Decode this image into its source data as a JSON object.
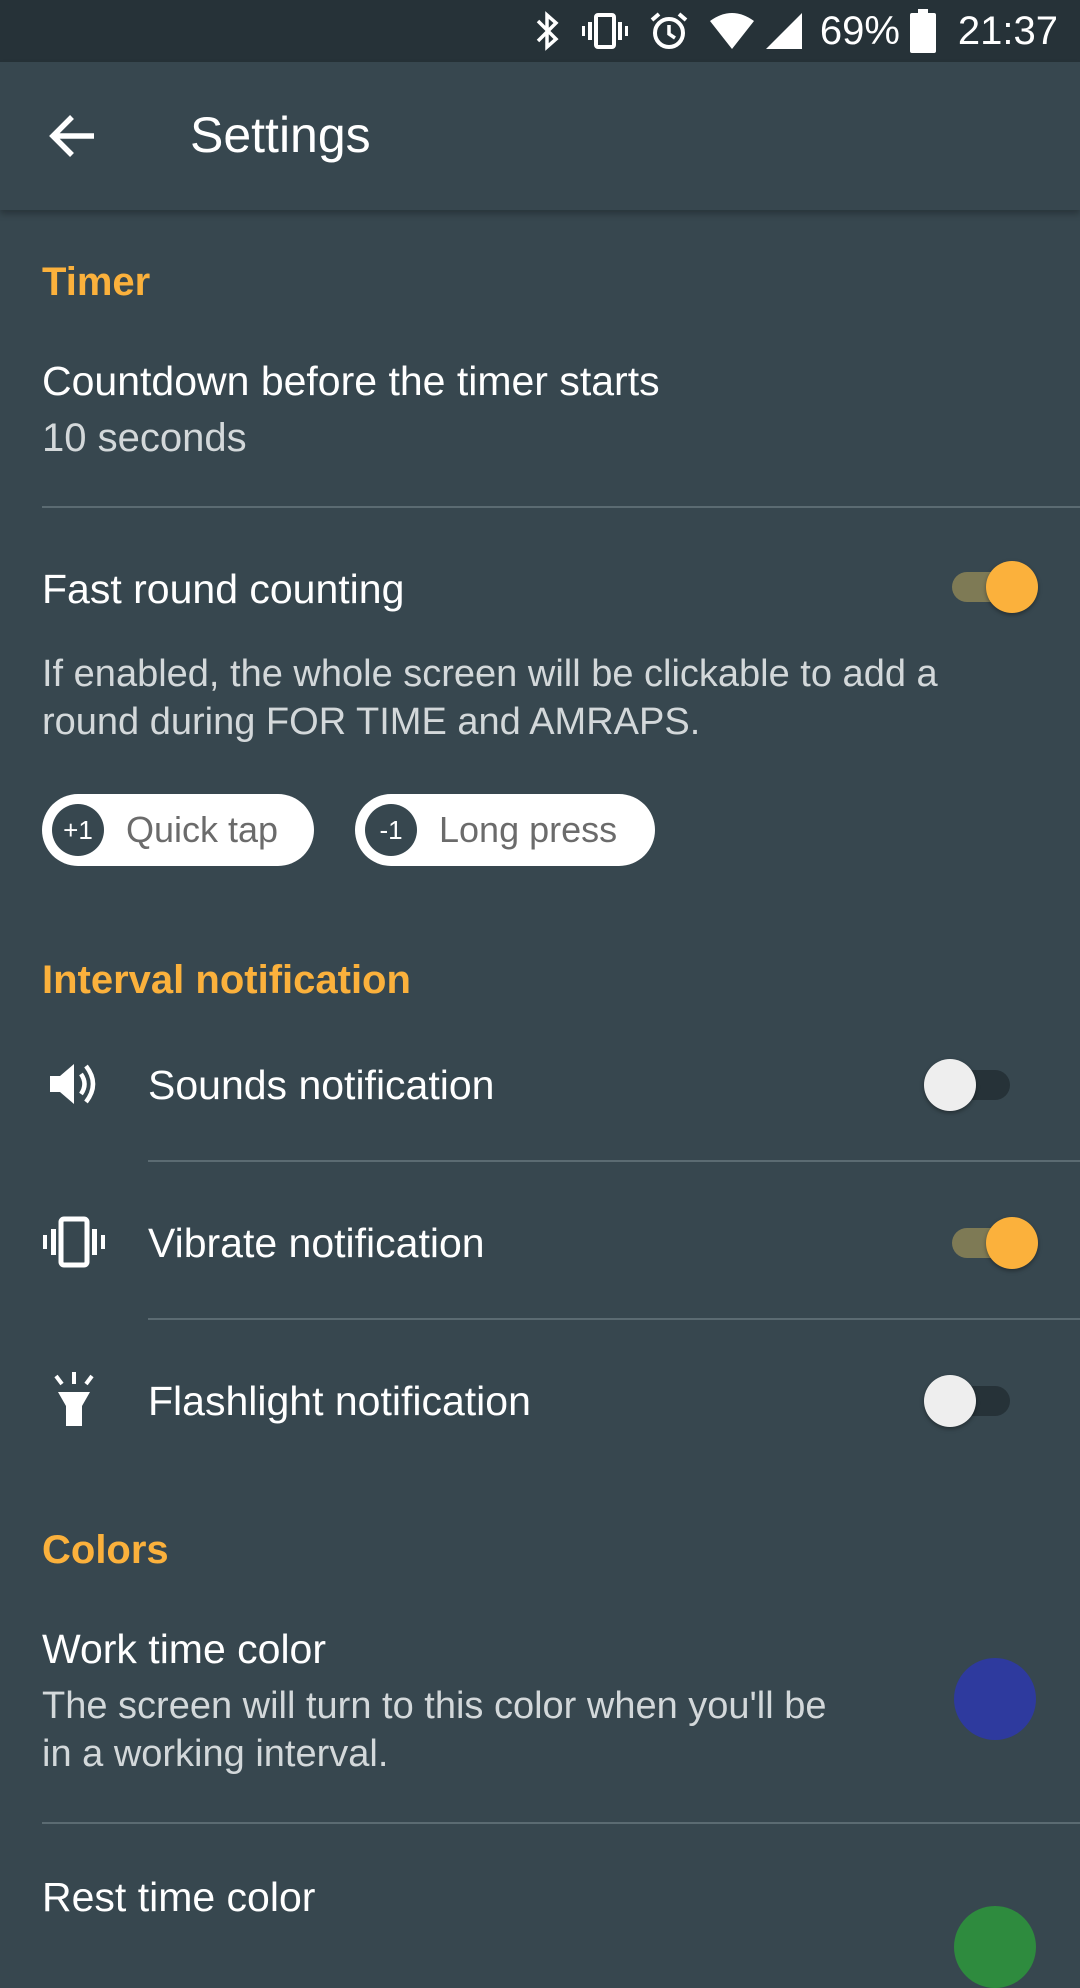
{
  "status_bar": {
    "battery": "69%",
    "time": "21:37",
    "icons": [
      "bluetooth-icon",
      "vibrate-icon",
      "alarm-icon",
      "wifi-icon",
      "signal-icon",
      "battery-icon"
    ]
  },
  "appbar": {
    "title": "Settings",
    "back_icon": "arrow-back-icon"
  },
  "accent_color": "#fbb13c",
  "sections": {
    "timer": {
      "header": "Timer",
      "countdown": {
        "title": "Countdown before the timer starts",
        "value": "10 seconds"
      },
      "fast_round": {
        "title": "Fast round counting",
        "enabled": true,
        "description_line1": "If enabled, the whole screen will be clickable to add a",
        "description_line2": "round during FOR TIME and AMRAPS.",
        "chips": [
          {
            "badge": "+1",
            "label": "Quick tap"
          },
          {
            "badge": "-1",
            "label": "Long press"
          }
        ]
      }
    },
    "interval": {
      "header": "Interval notification",
      "items": [
        {
          "label": "Sounds notification",
          "icon": "volume-icon",
          "enabled": false
        },
        {
          "label": "Vibrate notification",
          "icon": "vibrate-icon",
          "enabled": true
        },
        {
          "label": "Flashlight notification",
          "icon": "flashlight-icon",
          "enabled": false
        }
      ]
    },
    "colors": {
      "header": "Colors",
      "work": {
        "title": "Work time color",
        "description_line1": "The screen will turn to this color when you'll be",
        "description_line2": "in a working interval.",
        "color": "#2e3a9e"
      },
      "rest": {
        "title": "Rest time color",
        "color": "#2e8b3e"
      }
    }
  }
}
